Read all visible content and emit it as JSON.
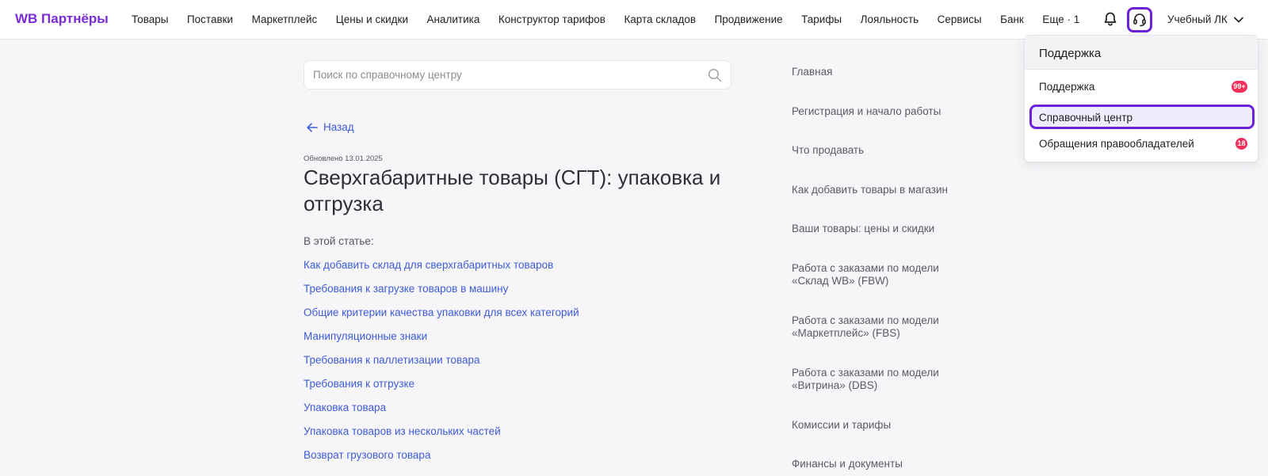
{
  "header": {
    "logo": "WB Партнёры",
    "nav": [
      "Товары",
      "Поставки",
      "Маркетплейс",
      "Цены и скидки",
      "Аналитика",
      "Конструктор тарифов",
      "Карта складов",
      "Продвижение",
      "Тарифы",
      "Лояльность",
      "Сервисы",
      "Банк",
      "Еще · 1"
    ],
    "account": "Учебный ЛК",
    "icons": {
      "bell": "bell-icon",
      "support": "headset-icon",
      "account": "chevron-down-icon"
    }
  },
  "search": {
    "placeholder": "Поиск по справочному центру",
    "value": ""
  },
  "article": {
    "back": "Назад",
    "updated": "Обновлено 13.01.2025",
    "title": "Сверхгабаритные товары (СГТ): упаковка и отгрузка",
    "toc_label": "В этой статье:",
    "toc": [
      "Как добавить склад для сверхгабаритных товаров",
      "Требования к загрузке товаров в машину",
      "Общие критерии качества упаковки для всех категорий",
      "Манипуляционные знаки",
      "Требования к паллетизации товара",
      "Требования к отгрузке",
      "Упаковка товара",
      "Упаковка товаров из нескольких частей",
      "Возврат грузового товара"
    ]
  },
  "sections": [
    "Главная",
    "Регистрация и начало работы",
    "Что продавать",
    "Как добавить товары в магазин",
    "Ваши товары: цены и скидки",
    "Работа с заказами по модели «Склад WB» (FBW)",
    "Работа с заказами по модели «Маркетплейс» (FBS)",
    "Работа с заказами по модели «Витрина» (DBS)",
    "Комиссии и тарифы",
    "Финансы и документы"
  ],
  "dropdown": {
    "title": "Поддержка",
    "items": [
      {
        "label": "Поддержка",
        "badge": "99+"
      },
      {
        "label": "Справочный центр",
        "badge": ""
      },
      {
        "label": "Обращения правообладателей",
        "badge": "18"
      }
    ]
  },
  "colors": {
    "accent": "#6d21d8",
    "link": "#3d5bd9",
    "badge": "#f0305b",
    "logo": "#7b2cd8"
  }
}
